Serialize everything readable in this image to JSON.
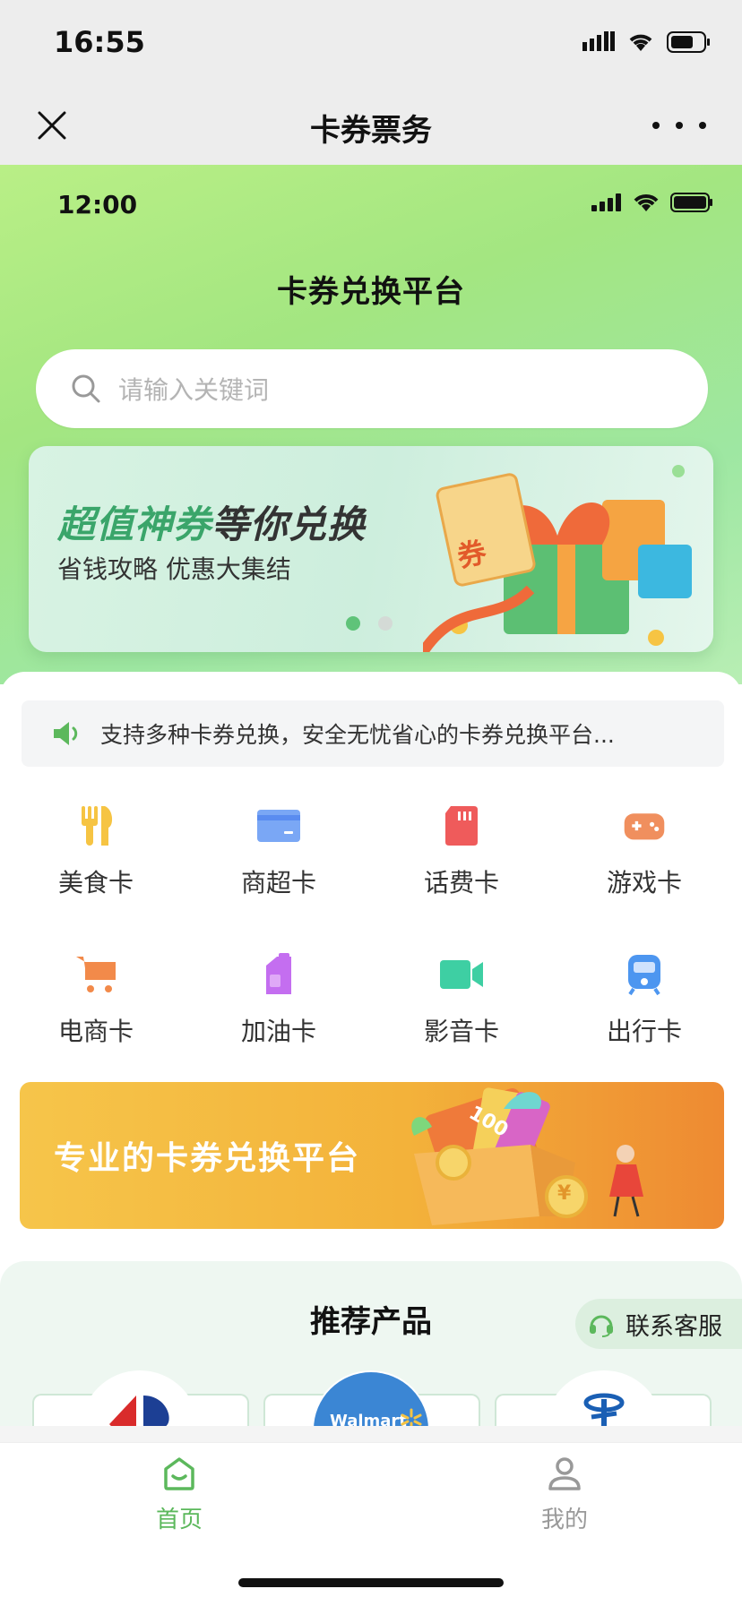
{
  "outer": {
    "time": "16:55",
    "nav_title": "卡券票务"
  },
  "inner": {
    "time": "12:00",
    "title": "卡券兑换平台"
  },
  "search": {
    "placeholder": "请输入关键词"
  },
  "banner": {
    "title_green": "超值神券",
    "title_dark": "等你兑换",
    "subtitle": "省钱攻略 优惠大集结",
    "tag": "券",
    "slide_count": 2,
    "active_slide": 1
  },
  "notice": {
    "text": "支持多种卡券兑换，安全无忧省心的卡券兑换平台..."
  },
  "categories": [
    {
      "label": "美食卡",
      "icon": "fork-knife-icon",
      "color": "#f6c443"
    },
    {
      "label": "商超卡",
      "icon": "card-icon",
      "color": "#5a8cf0"
    },
    {
      "label": "话费卡",
      "icon": "sim-card-icon",
      "color": "#ef5b5b"
    },
    {
      "label": "游戏卡",
      "icon": "gamepad-icon",
      "color": "#f08f5e"
    },
    {
      "label": "电商卡",
      "icon": "cart-icon",
      "color": "#f28a4a"
    },
    {
      "label": "加油卡",
      "icon": "fuel-can-icon",
      "color": "#c46ef0"
    },
    {
      "label": "影音卡",
      "icon": "video-camera-icon",
      "color": "#3ecfa3"
    },
    {
      "label": "出行卡",
      "icon": "train-icon",
      "color": "#4d96f0"
    }
  ],
  "promo": {
    "text": "专业的卡券兑换平台",
    "card_number": "100",
    "coin_symbol": "¥"
  },
  "recommend": {
    "title": "推荐产品",
    "contact_label": "联系客服",
    "brands": [
      "Walmart"
    ]
  },
  "tabbar": {
    "items": [
      {
        "label": "首页",
        "icon": "home-icon",
        "active": true
      },
      {
        "label": "我的",
        "icon": "user-icon",
        "active": false
      }
    ],
    "active_color": "#5cb85c",
    "inactive_color": "#999999"
  }
}
